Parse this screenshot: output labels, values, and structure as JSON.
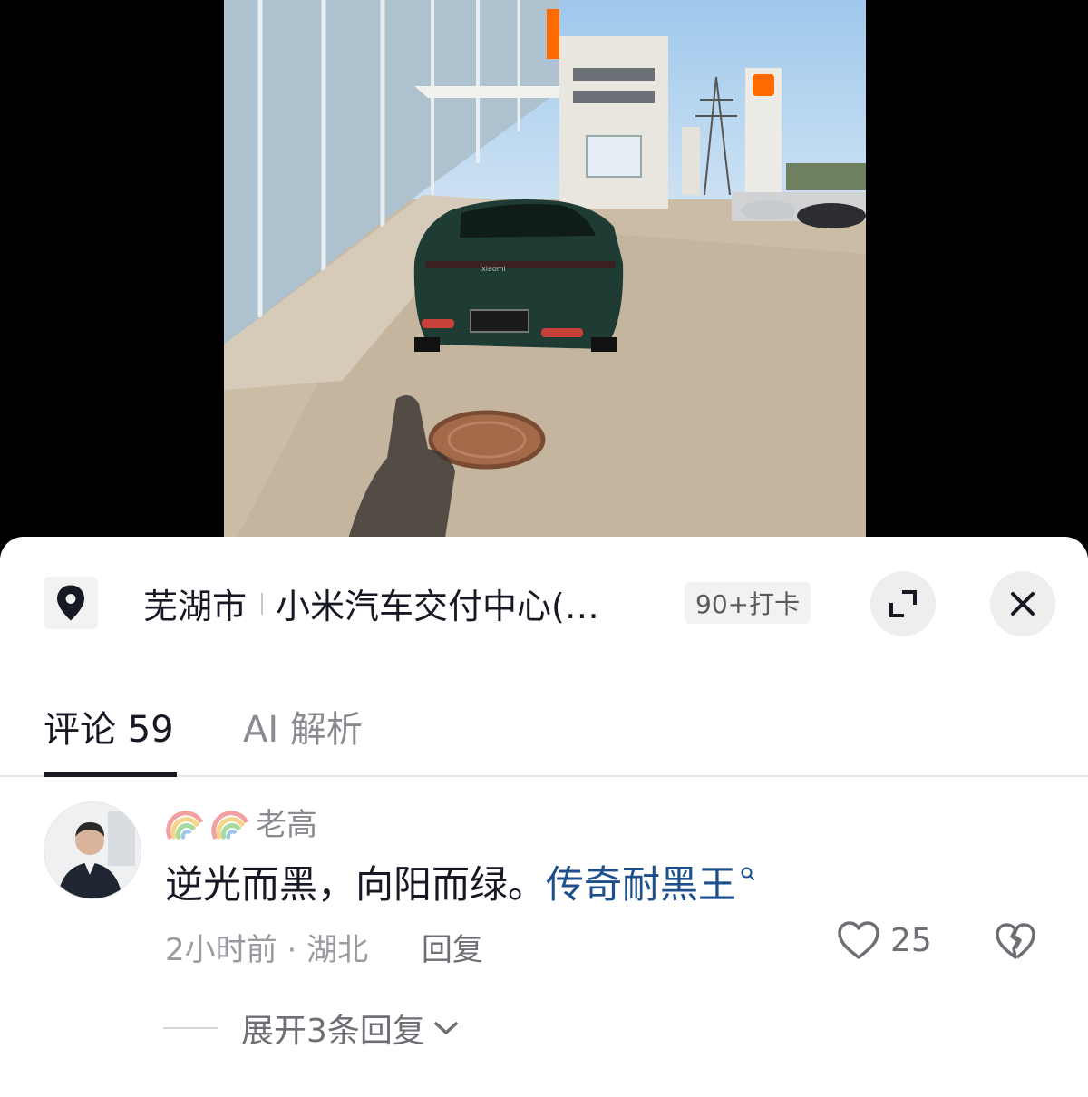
{
  "location": {
    "city": "芜湖市",
    "place": "小米汽车交付中心(…",
    "checkins": "90+打卡"
  },
  "tabs": [
    {
      "label": "评论 59",
      "active": true
    },
    {
      "label": "AI 解析",
      "active": false
    }
  ],
  "comment": {
    "username": "老高",
    "text": "逆光而黑，向阳而绿。",
    "highlight_link": "传奇耐黑王",
    "time": "2小时前",
    "region": "湖北",
    "reply_label": "回复",
    "likes": "25",
    "expand_replies": "展开3条回复"
  },
  "video": {
    "sign_text": "xiaomi"
  },
  "icons": {
    "location": "location-pin-icon",
    "expand": "expand-icon",
    "close": "close-icon",
    "like": "heart-icon",
    "dislike": "broken-heart-icon",
    "search": "search-icon",
    "chevron": "chevron-down-icon",
    "emoji": "rainbow-icon"
  },
  "colors": {
    "text_primary": "#161823",
    "text_secondary": "#8a8b91",
    "link": "#1c4f8c",
    "car_green": "#1e3b34"
  }
}
